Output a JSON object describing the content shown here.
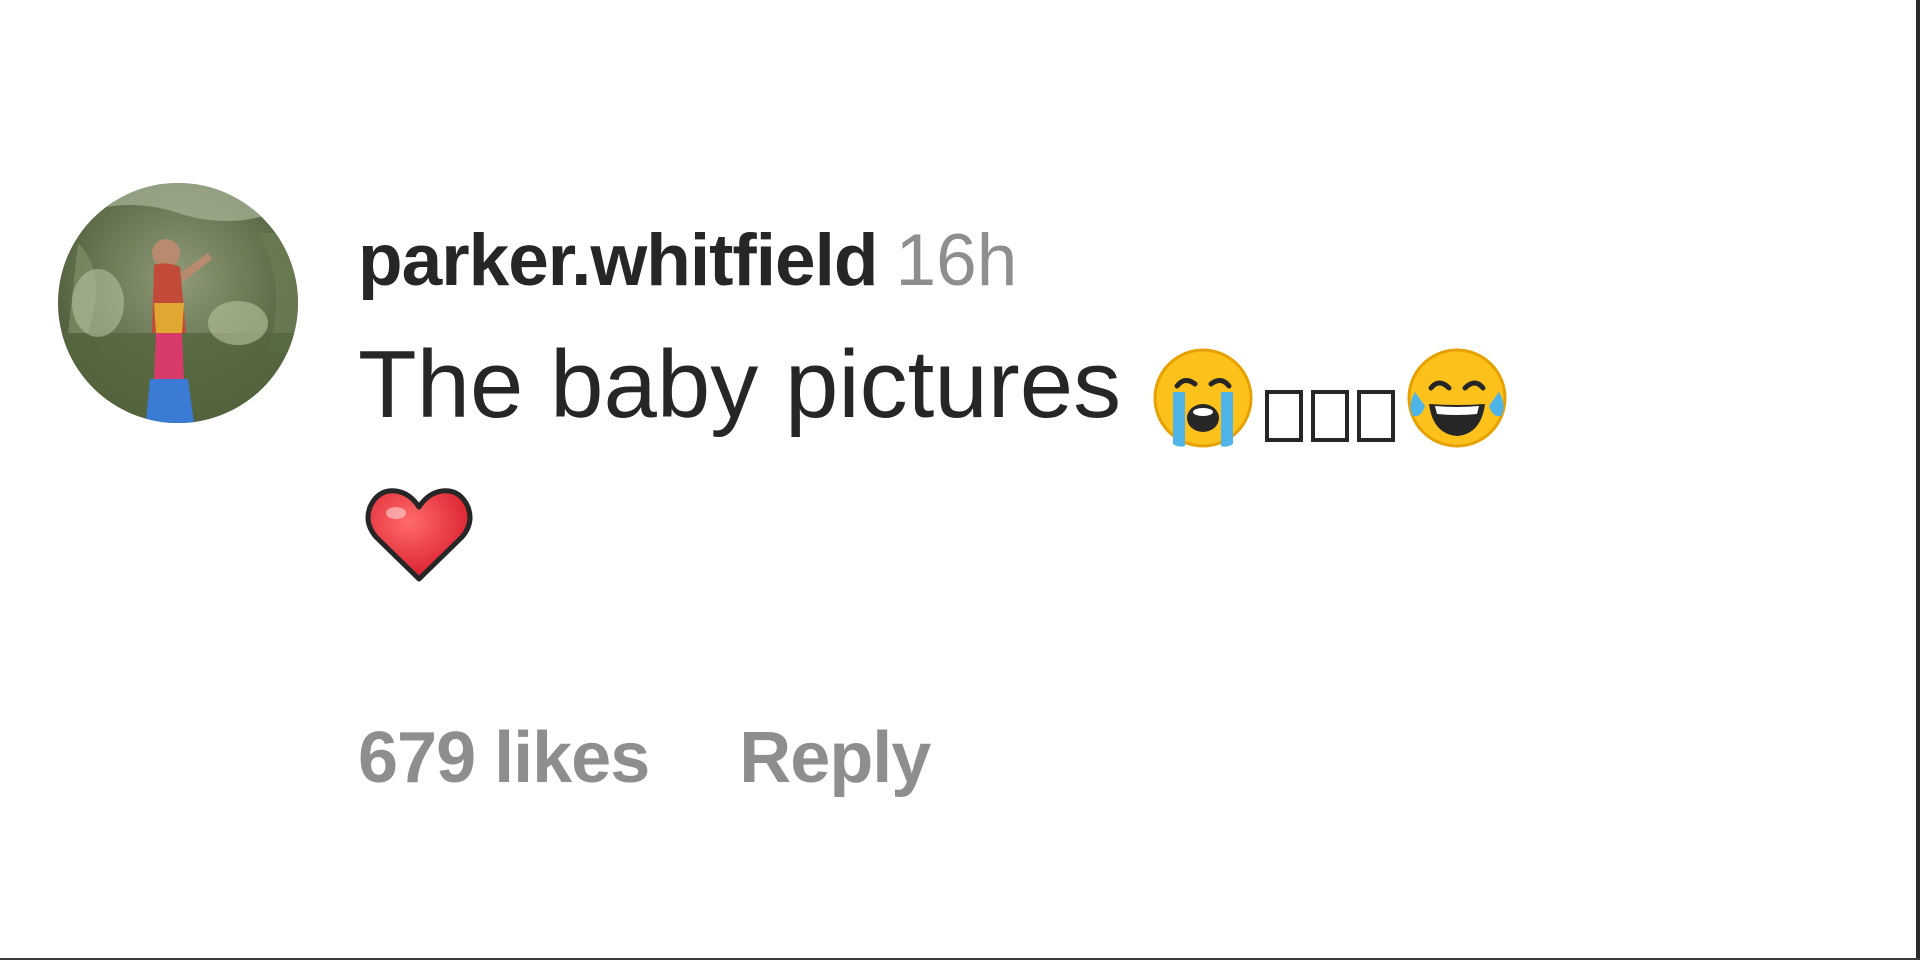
{
  "comment": {
    "username": "parker.whitfield",
    "timestamp": "16h",
    "text": "The baby pictures",
    "emojis": [
      "loudly-crying-face",
      "unrendered-glyph",
      "unrendered-glyph",
      "unrendered-glyph",
      "face-with-tears-of-joy",
      "red-heart"
    ],
    "likes_label": "679 likes",
    "reply_label": "Reply"
  },
  "colors": {
    "text": "#262626",
    "secondary": "#8e8e8e",
    "background": "#ffffff"
  }
}
